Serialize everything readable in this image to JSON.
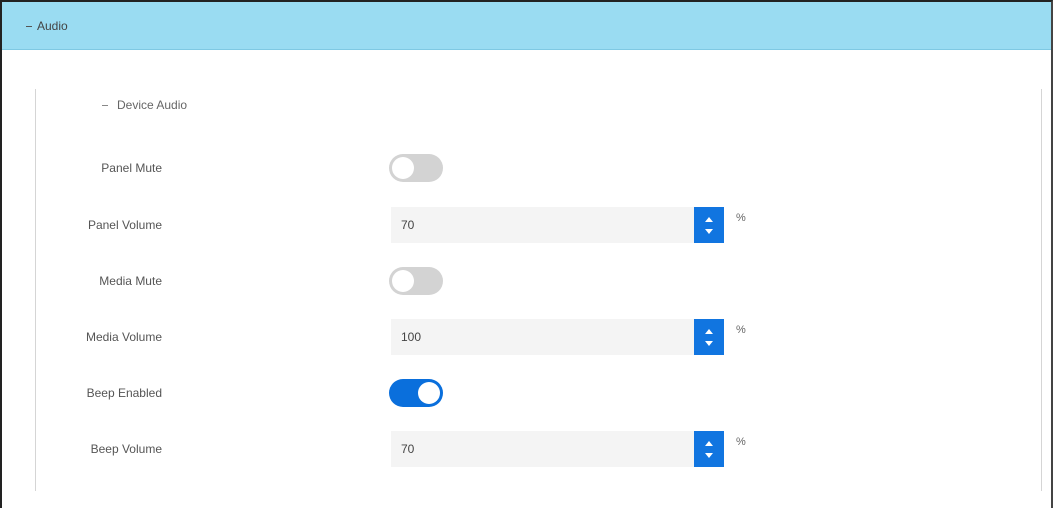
{
  "header": {
    "title": "Audio"
  },
  "section": {
    "title": "Device Audio",
    "rows": [
      {
        "label": "Panel Mute",
        "type": "toggle",
        "on": false
      },
      {
        "label": "Panel Volume",
        "type": "spinner",
        "value": "70",
        "unit": "%"
      },
      {
        "label": "Media Mute",
        "type": "toggle",
        "on": false
      },
      {
        "label": "Media Volume",
        "type": "spinner",
        "value": "100",
        "unit": "%"
      },
      {
        "label": "Beep Enabled",
        "type": "toggle",
        "on": true
      },
      {
        "label": "Beep Volume",
        "type": "spinner",
        "value": "70",
        "unit": "%"
      }
    ]
  },
  "colors": {
    "header_bg": "#9adcf2",
    "accent": "#1175e0",
    "toggle_off": "#d3d3d3",
    "input_bg": "#f4f4f4"
  },
  "icons": {
    "header_toggle": "minus-icon",
    "section_toggle": "minus-icon",
    "spinner_up": "arrow-up-icon",
    "spinner_down": "arrow-down-icon"
  }
}
